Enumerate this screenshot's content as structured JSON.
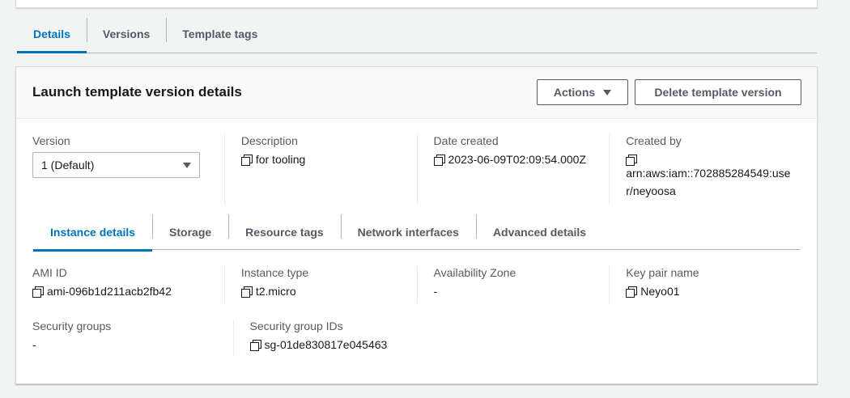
{
  "outer_tabs": [
    {
      "label": "Details",
      "active": true
    },
    {
      "label": "Versions",
      "active": false
    },
    {
      "label": "Template tags",
      "active": false
    }
  ],
  "panel": {
    "title": "Launch template version details",
    "actions_label": "Actions",
    "delete_label": "Delete template version"
  },
  "summary": {
    "version_label": "Version",
    "version_value": "1 (Default)",
    "description_label": "Description",
    "description_value": "for tooling",
    "date_label": "Date created",
    "date_value": "2023-06-09T02:09:54.000Z",
    "created_by_label": "Created by",
    "created_by_value": "arn:aws:iam::702885284549:user/neyoosa"
  },
  "inner_tabs": [
    {
      "label": "Instance details",
      "active": true
    },
    {
      "label": "Storage",
      "active": false
    },
    {
      "label": "Resource tags",
      "active": false
    },
    {
      "label": "Network interfaces",
      "active": false
    },
    {
      "label": "Advanced details",
      "active": false
    }
  ],
  "instance": {
    "ami_label": "AMI ID",
    "ami_value": "ami-096b1d211acb2fb42",
    "type_label": "Instance type",
    "type_value": "t2.micro",
    "az_label": "Availability Zone",
    "az_value": "-",
    "keypair_label": "Key pair name",
    "keypair_value": "Neyo01",
    "sg_label": "Security groups",
    "sg_value": "-",
    "sgids_label": "Security group IDs",
    "sgids_value": "sg-01de830817e045463"
  },
  "colors": {
    "accent": "#0073bb",
    "text": "#16191f",
    "muted": "#545b64",
    "background": "#f2f3f3"
  }
}
